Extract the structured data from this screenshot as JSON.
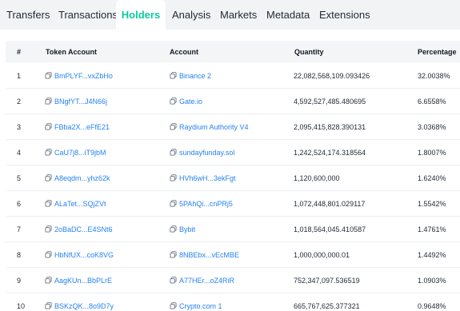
{
  "tabs": [
    {
      "label": "Transfers"
    },
    {
      "label": "Transactions"
    },
    {
      "label": "Holders",
      "active": true
    },
    {
      "label": "Analysis"
    },
    {
      "label": "Markets"
    },
    {
      "label": "Metadata"
    },
    {
      "label": "Extensions"
    }
  ],
  "colors": {
    "accent": "#0ec9a0",
    "link": "#2582f0",
    "header_bg": "#f4f5f7"
  },
  "table": {
    "headers": {
      "rank": "#",
      "token_account": "Token Account",
      "account": "Account",
      "quantity": "Quantity",
      "percentage": "Percentage"
    },
    "rows": [
      {
        "rank": "1",
        "token_account": "BmPLYF...vxZbHo",
        "account": "Binance 2",
        "quantity": "22,082,568,109.093426",
        "percentage": "32.0038%"
      },
      {
        "rank": "2",
        "token_account": "BNgfYT...J4N66j",
        "account": "Gate.io",
        "quantity": "4,592,527,485.480695",
        "percentage": "6.6558%"
      },
      {
        "rank": "3",
        "token_account": "FBba2X...eFfE21",
        "account": "Raydium Authority V4",
        "quantity": "2,095,415,828.390131",
        "percentage": "3.0368%"
      },
      {
        "rank": "4",
        "token_account": "CaU7j8...iT9jbM",
        "account": "sundayfunday.sol",
        "quantity": "1,242,524,174.318564",
        "percentage": "1.8007%"
      },
      {
        "rank": "5",
        "token_account": "A8eqdm...yhz62k",
        "account": "HVh6wH...3ekFgt",
        "quantity": "1,120,600,000",
        "percentage": "1.6240%"
      },
      {
        "rank": "6",
        "token_account": "ALaTet...SQjZVt",
        "account": "5PAhQi...cnPRj5",
        "quantity": "1,072,448,801.029117",
        "percentage": "1.5542%"
      },
      {
        "rank": "7",
        "token_account": "2oBaDC...E4SNt6",
        "account": "Bybit",
        "quantity": "1,018,564,045.410587",
        "percentage": "1.4761%"
      },
      {
        "rank": "8",
        "token_account": "HbNfUX...coK8VG",
        "account": "8NBEbx...vEcMBE",
        "quantity": "1,000,000,000.01",
        "percentage": "1.4492%"
      },
      {
        "rank": "9",
        "token_account": "AagKUn...BbPLrE",
        "account": "A77HEr...oZ4RiR",
        "quantity": "752,347,097.536519",
        "percentage": "1.0903%"
      },
      {
        "rank": "10",
        "token_account": "BSKzQK...8o9D7y",
        "account": "Crypto.com 1",
        "quantity": "665,767,625.377321",
        "percentage": "0.9648%"
      }
    ]
  }
}
